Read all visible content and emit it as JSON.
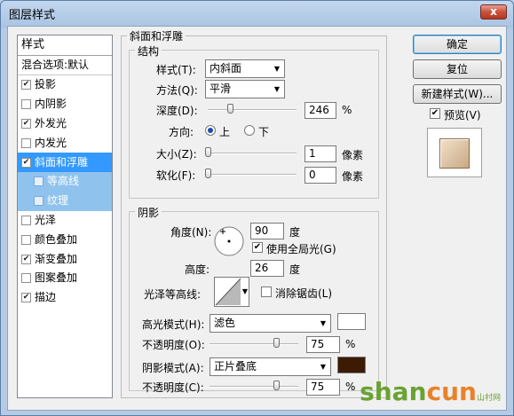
{
  "window": {
    "title": "图层样式",
    "close_glyph": "x"
  },
  "stylelist": {
    "header": "样式",
    "blend_options": "混合选项:默认",
    "items": [
      {
        "label": "投影",
        "checked": true
      },
      {
        "label": "内阴影",
        "checked": false
      },
      {
        "label": "外发光",
        "checked": true
      },
      {
        "label": "内发光",
        "checked": false
      },
      {
        "label": "斜面和浮雕",
        "checked": true,
        "selected": true
      },
      {
        "label": "等高线",
        "checked": false,
        "sub": true
      },
      {
        "label": "纹理",
        "checked": false,
        "sub": true
      },
      {
        "label": "光泽",
        "checked": false
      },
      {
        "label": "颜色叠加",
        "checked": false
      },
      {
        "label": "渐变叠加",
        "checked": true
      },
      {
        "label": "图案叠加",
        "checked": false
      },
      {
        "label": "描边",
        "checked": true
      }
    ]
  },
  "bevel": {
    "title": "斜面和浮雕",
    "structure": {
      "title": "结构",
      "style_label": "样式(T):",
      "style_value": "内斜面",
      "technique_label": "方法(Q):",
      "technique_value": "平滑",
      "depth_label": "深度(D):",
      "depth_value": "246",
      "depth_unit": "%",
      "depth_level": 0.246,
      "direction_label": "方向:",
      "direction_up": "上",
      "direction_down": "下",
      "size_label": "大小(Z):",
      "size_value": "1",
      "size_unit": "像素",
      "size_level": 0.0,
      "soften_label": "软化(F):",
      "soften_value": "0",
      "soften_unit": "像素",
      "soften_level": 0.0
    },
    "shading": {
      "title": "阴影",
      "angle_label": "角度(N):",
      "angle_value": "90",
      "angle_unit": "度",
      "global_light_label": "使用全局光(G)",
      "global_light_checked": true,
      "altitude_label": "高度:",
      "altitude_value": "26",
      "altitude_unit": "度",
      "gloss_label": "光泽等高线:",
      "antialias_label": "消除锯齿(L)",
      "antialias_checked": false,
      "highlight_mode_label": "高光模式(H):",
      "highlight_mode_value": "滤色",
      "highlight_color": "#ffffff",
      "highlight_opacity_label": "不透明度(O):",
      "highlight_opacity_value": "75",
      "highlight_opacity_unit": "%",
      "highlight_opacity_level": 0.75,
      "shadow_mode_label": "阴影模式(A):",
      "shadow_mode_value": "正片叠底",
      "shadow_color": "#3c1a04",
      "shadow_opacity_label": "不透明度(C):",
      "shadow_opacity_value": "75",
      "shadow_opacity_unit": "%",
      "shadow_opacity_level": 0.75
    }
  },
  "buttons": {
    "ok": "确定",
    "reset": "复位",
    "new_style": "新建样式(W)...",
    "preview_label": "预览(V)",
    "preview_checked": true
  },
  "watermark": {
    "text": "shancun",
    "suffix": "山村网"
  }
}
